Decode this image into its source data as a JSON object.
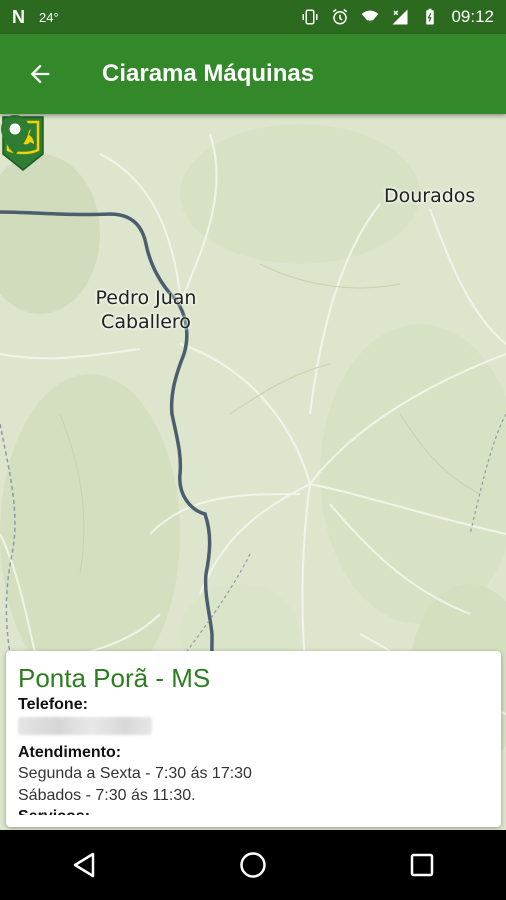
{
  "status_bar": {
    "left_icon": "N",
    "temperature": "24°",
    "time": "09:12",
    "icons": [
      "vibrate-icon",
      "alarm-icon",
      "wifi-icon",
      "signal-icon",
      "battery-icon"
    ]
  },
  "app_bar": {
    "title": "Ciarama Máquinas",
    "back_icon": "arrow-left-icon"
  },
  "map": {
    "labels": {
      "dourados": "Dourados",
      "pedro_line1": "Pedro Juan",
      "pedro_line2": "Caballero"
    },
    "markers": [
      "john-deere-dealer-marker",
      "location-pin-marker"
    ],
    "colors": {
      "marker_green": "#2e7d32",
      "jd_yellow": "#f2d300"
    }
  },
  "info_card": {
    "title": "Ponta Porã - MS",
    "phone_label": "Telefone:",
    "hours_label": "Atendimento:",
    "hours_weekdays": "Segunda a Sexta - 7:30 ás 17:30",
    "hours_saturday": "Sábados - 7:30 ás 11:30.",
    "services_label": "Serviços:"
  },
  "nav_bar": {
    "icons": [
      "back-triangle-icon",
      "home-circle-icon",
      "recents-square-icon"
    ]
  },
  "theme": {
    "status_bar_color": "#2b6a1f",
    "app_bar_color": "#33882a",
    "title_green": "#2e7d22"
  }
}
